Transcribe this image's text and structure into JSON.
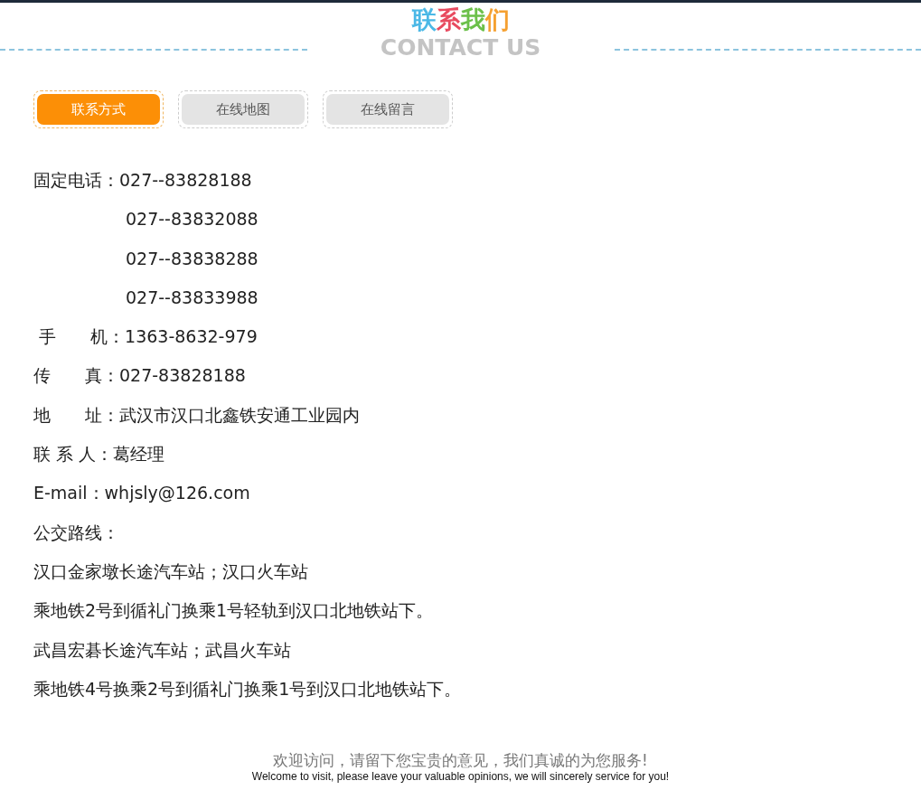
{
  "header": {
    "title": [
      {
        "char": "联",
        "color": "#4bb8e6"
      },
      {
        "char": "系",
        "color": "#e84a5f"
      },
      {
        "char": "我",
        "color": "#6cc04a"
      },
      {
        "char": "们",
        "color": "#f5a030"
      }
    ],
    "subtitle": "CONTACT US"
  },
  "tabs": [
    {
      "label": "联系方式",
      "selected": true
    },
    {
      "label": "在线地图",
      "selected": false
    },
    {
      "label": "在线留言",
      "selected": false
    }
  ],
  "lines": [
    {
      "kind": "field",
      "text": "固定电话：027--83828188"
    },
    {
      "kind": "continuation",
      "text": "027--83832088"
    },
    {
      "kind": "continuation",
      "text": "027--83838288"
    },
    {
      "kind": "continuation",
      "text": "027--83833988"
    },
    {
      "kind": "field",
      "text": " 手　　机：1363-8632-979"
    },
    {
      "kind": "field",
      "text": "传　　真：027-83828188"
    },
    {
      "kind": "field",
      "text": "地　　址：武汉市汉口北鑫铁安通工业园内"
    },
    {
      "kind": "field",
      "text": "联 系 人：葛经理"
    },
    {
      "kind": "field",
      "text": "E-mail：whjsly@126.com"
    },
    {
      "kind": "field",
      "text": "公交路线："
    },
    {
      "kind": "field",
      "text": "汉口金家墩长途汽车站；汉口火车站"
    },
    {
      "kind": "field",
      "text": "乘地铁2号到循礼门换乘1号轻轨到汉口北地铁站下。"
    },
    {
      "kind": "field",
      "text": "武昌宏碁长途汽车站；武昌火车站"
    },
    {
      "kind": "field",
      "text": "乘地铁4号换乘2号到循礼门换乘1号到汉口北地铁站下。"
    }
  ],
  "footer": {
    "message": "欢迎访问，请留下您宝贵的意见，我们真诚的为您服务!",
    "english": "Welcome to visit, please leave your valuable opinions, we will sincerely service for you!"
  }
}
